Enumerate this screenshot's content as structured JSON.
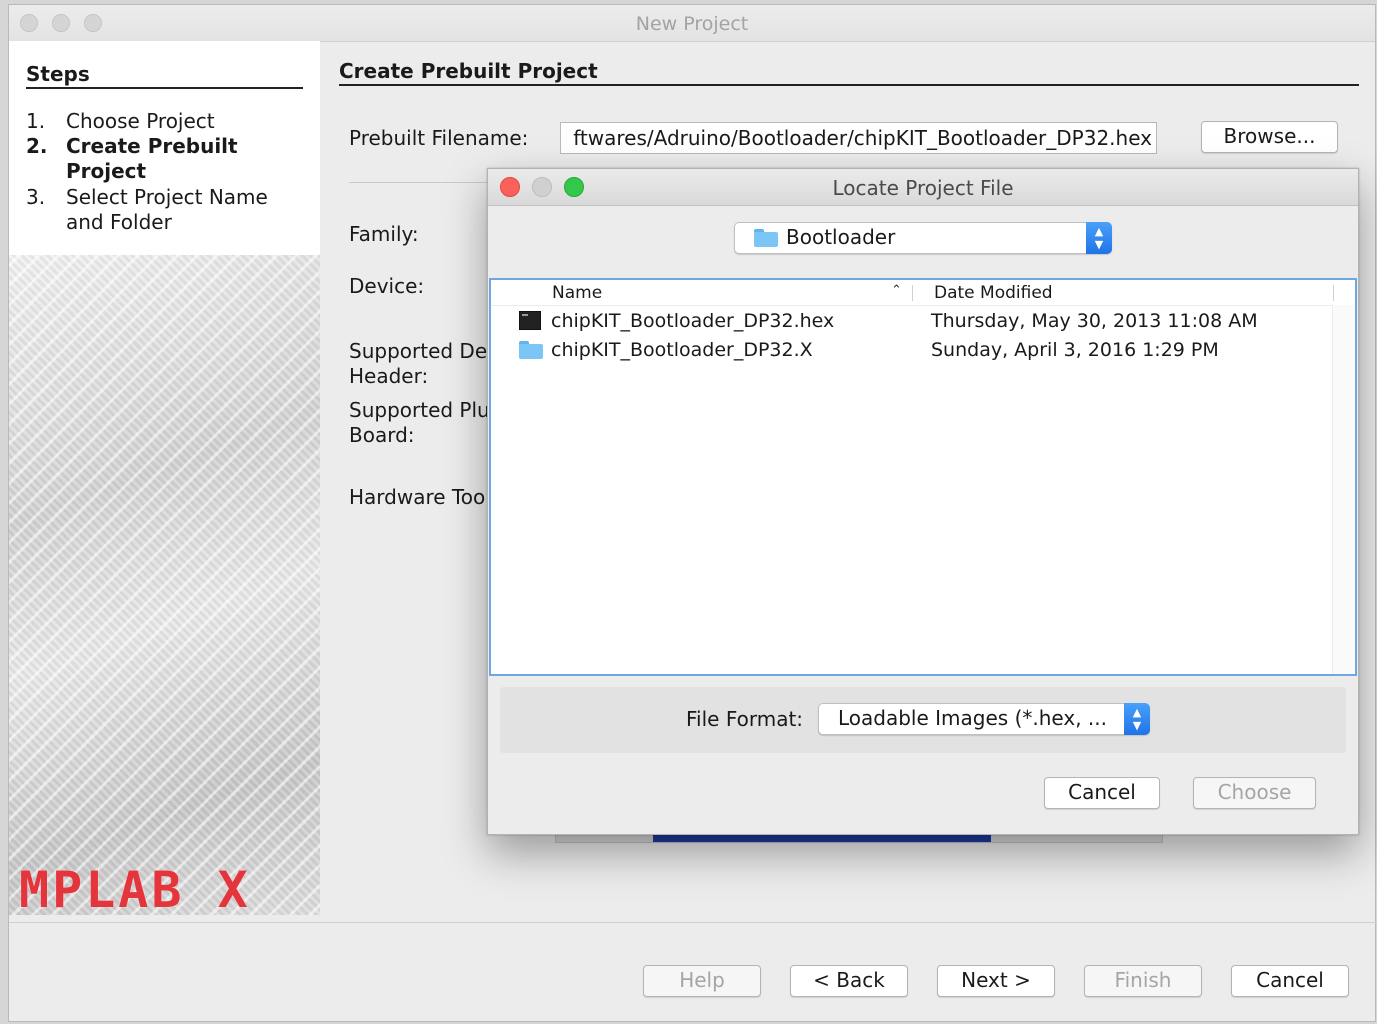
{
  "window": {
    "title": "New Project"
  },
  "steps": {
    "heading": "Steps",
    "items": [
      {
        "num": "1.",
        "label": "Choose Project"
      },
      {
        "num": "2.",
        "label": "Create Prebuilt Project"
      },
      {
        "num": "3.",
        "label": "Select Project Name and Folder"
      }
    ]
  },
  "brand": {
    "logo_text": "MPLAB X",
    "logo_color": "#e4343c"
  },
  "content": {
    "heading": "Create Prebuilt Project",
    "prebuilt_label": "Prebuilt Filename:",
    "prebuilt_value": "ftwares/Adruino/Bootloader/chipKIT_Bootloader_DP32.hex",
    "browse_label": "Browse...",
    "family_label": "Family:",
    "device_label": "Device:",
    "supported_debug_label": "Supported Del Header:",
    "supported_debug_line1": "Supported Del",
    "supported_debug_line2": "Header:",
    "supported_plugin_line1": "Supported Plu",
    "supported_plugin_line2": "Board:",
    "hardware_tool_label": "Hardware Too"
  },
  "footer": {
    "help": "Help",
    "back": "< Back",
    "next": "Next >",
    "finish": "Finish",
    "cancel": "Cancel"
  },
  "dialog": {
    "title": "Locate Project File",
    "location": "Bootloader",
    "columns": {
      "name": "Name",
      "date": "Date Modified"
    },
    "files": [
      {
        "icon": "terminal-file-icon",
        "name": "chipKIT_Bootloader_DP32.hex",
        "date": "Thursday, May 30, 2013 11:08 AM"
      },
      {
        "icon": "folder-icon",
        "name": "chipKIT_Bootloader_DP32.X",
        "date": "Sunday, April 3, 2016 1:29 PM"
      }
    ],
    "file_format_label": "File Format:",
    "file_format_value": "Loadable Images (*.hex, ...",
    "cancel": "Cancel",
    "choose": "Choose",
    "accent": "#1f74e8"
  }
}
